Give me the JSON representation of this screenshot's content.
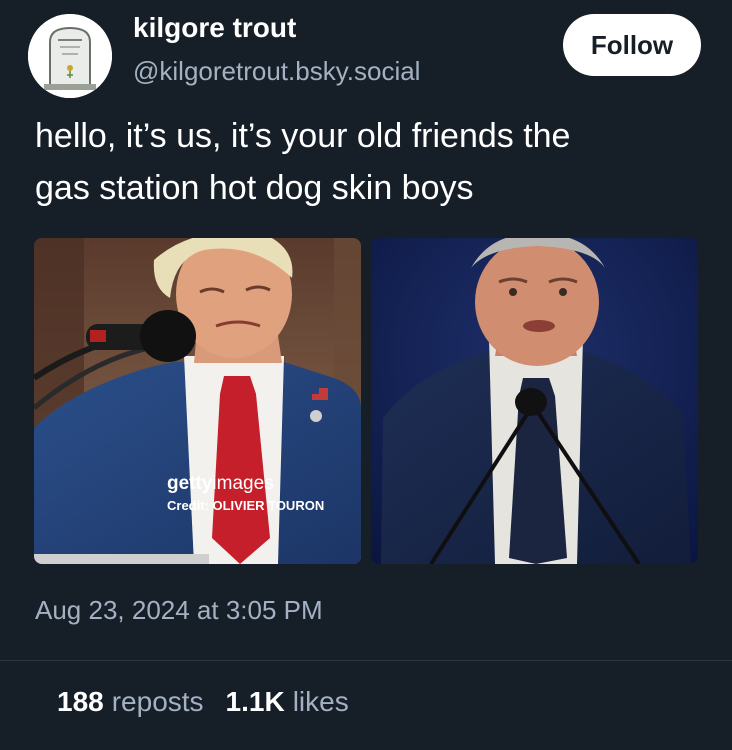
{
  "author": {
    "display_name": "kilgore trout",
    "handle": "@kilgoretrout.bsky.social",
    "avatar_icon": "tombstone-avatar-icon"
  },
  "follow_button": {
    "label": "Follow"
  },
  "post": {
    "text_lines": [
      "hello, it’s us, it’s your old friends the",
      "gas station hot dog skin boys"
    ],
    "images": [
      {
        "watermark_brand_bold": "getty",
        "watermark_brand_light": "images",
        "watermark_credit": "Credit: OLIVIER TOURON"
      },
      {}
    ],
    "timestamp": "Aug 23, 2024 at 3:05 PM"
  },
  "stats": {
    "reposts_count": "188",
    "reposts_label": "reposts",
    "likes_count": "1.1K",
    "likes_label": "likes"
  },
  "colors": {
    "background": "#161e27",
    "primary_text": "#ffffff",
    "secondary_text": "#a3b1c2",
    "divider": "#2b3744",
    "follow_button_bg": "#ffffff"
  }
}
